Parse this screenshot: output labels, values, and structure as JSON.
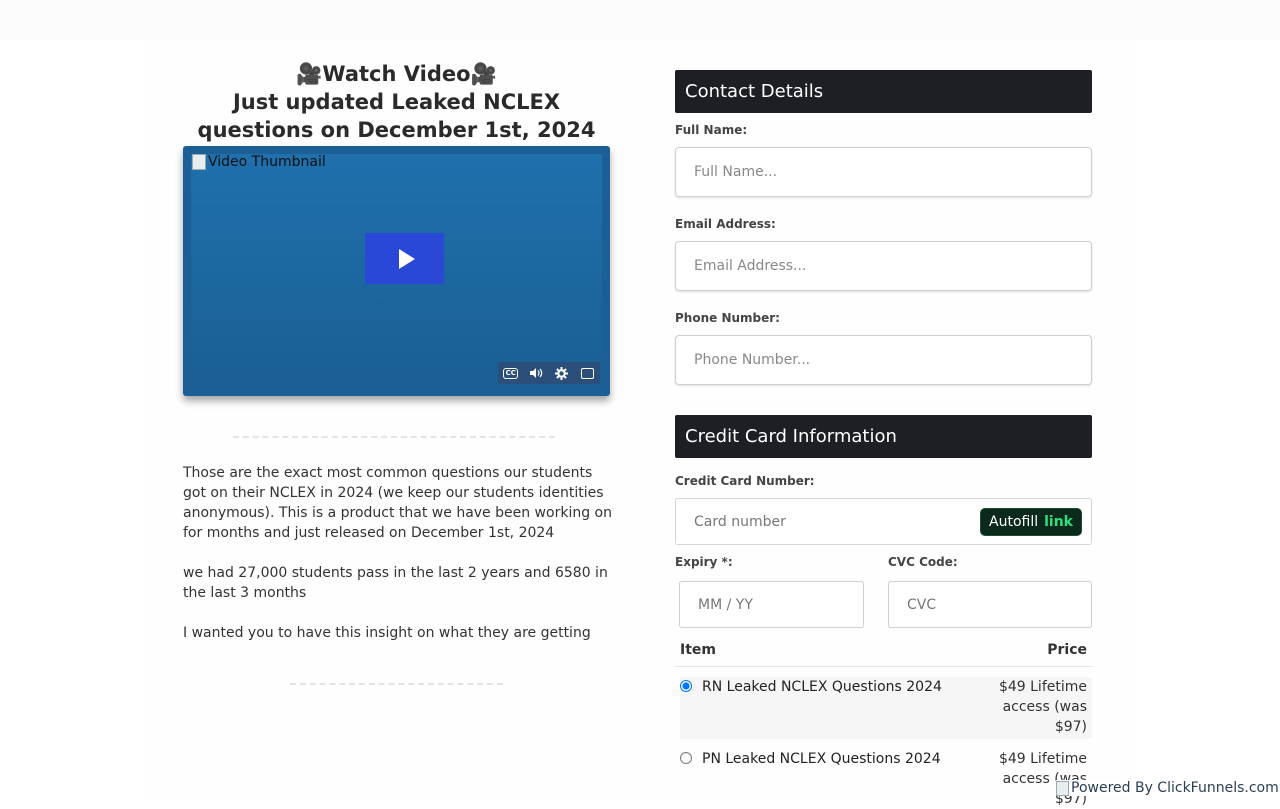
{
  "headline": {
    "line1": "🎥Watch Video🎥",
    "line2": "Just updated Leaked NCLEX questions on December 1st, 2024"
  },
  "video": {
    "thumbnail_alt": "Video Thumbnail",
    "controls": [
      "captions-icon",
      "volume-icon",
      "settings-icon",
      "fullscreen-icon"
    ],
    "cc_text": "CC"
  },
  "body": {
    "p1": "Those are the exact most common questions our students got on their NCLEX in 2024 (we keep our students identities anonymous). This is a product that we have been working on for months and just released on December 1st, 2024",
    "p2": "we had 27,000 students pass in the last 2 years and 6580 in the last 3 months",
    "p3": "I wanted you to have this insight on what they are getting"
  },
  "contact": {
    "title": "Contact Details",
    "full_name_label": "Full Name:",
    "full_name_placeholder": "Full Name...",
    "email_label": "Email Address:",
    "email_placeholder": "Email Address...",
    "phone_label": "Phone Number:",
    "phone_placeholder": "Phone Number..."
  },
  "card": {
    "title": "Credit Card Information",
    "number_label": "Credit Card Number:",
    "number_placeholder": "Card number",
    "autofill_label": "Autofill",
    "autofill_link": "link",
    "expiry_label": "Expiry *:",
    "expiry_placeholder": "MM / YY",
    "cvc_label": "CVC Code:",
    "cvc_placeholder": "CVC"
  },
  "items": {
    "col_item": "Item",
    "col_price": "Price",
    "rows": [
      {
        "name": "RN Leaked NCLEX Questions 2024",
        "price": "$49 Lifetime access (was $97)",
        "selected": true
      },
      {
        "name": "PN Leaked NCLEX Questions 2024",
        "price": "$49 Lifetime access (was $97)",
        "selected": false
      }
    ]
  },
  "footer": {
    "powered_by": "Powered By ClickFunnels.com"
  },
  "colors": {
    "section_header_bg": "#1c1f24",
    "play_button": "#2a48d8",
    "autofill_bg": "#0b2a1b",
    "autofill_link": "#2ee07d"
  }
}
